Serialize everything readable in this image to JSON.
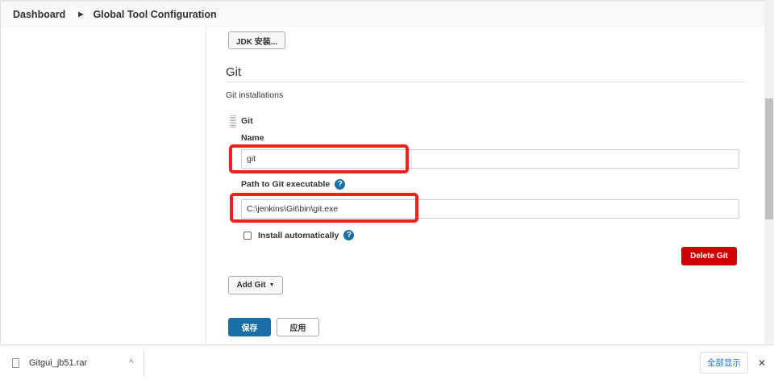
{
  "breadcrumb": {
    "items": [
      "Dashboard",
      "Global Tool Configuration"
    ]
  },
  "jdk_button": "JDK 安装...",
  "git": {
    "heading": "Git",
    "installations_label": "Git installations",
    "entry_title": "Git",
    "name_label": "Name",
    "name_value": "git",
    "path_label": "Path to Git executable",
    "path_value": "C:\\jenkins\\Git\\bin\\git.exe",
    "install_auto_label": "Install automatically",
    "install_auto_checked": false,
    "delete_button": "Delete Git",
    "add_button": "Add Git"
  },
  "actions": {
    "save": "保存",
    "apply": "应用"
  },
  "download_bar": {
    "file_name": "Gitgui_jb51.rar",
    "show_all": "全部显示",
    "close": "✕"
  },
  "colors": {
    "accent": "#1a6fa6",
    "danger": "#cc0003",
    "highlight": "#f0201a"
  }
}
